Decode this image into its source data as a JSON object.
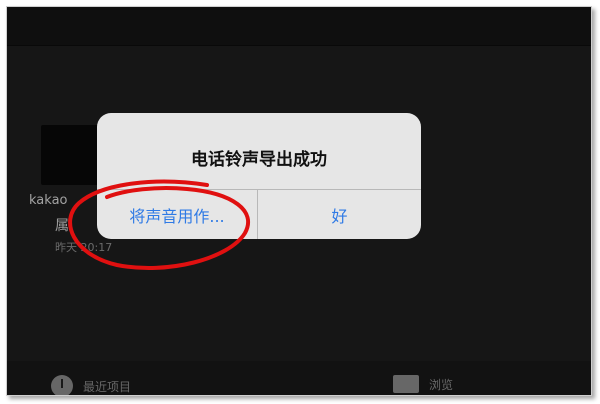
{
  "file_item": {
    "name": "kakao",
    "sub_label": "属",
    "time": "昨天 20:17"
  },
  "bottom_tabs": {
    "recent": "最近项目",
    "browse": "浏览"
  },
  "alert": {
    "title": "电话铃声导出成功",
    "left_button": "将声音用作...",
    "right_button": "好"
  },
  "colors": {
    "alert_button": "#2f7ae5",
    "annotation": "#e01010"
  }
}
